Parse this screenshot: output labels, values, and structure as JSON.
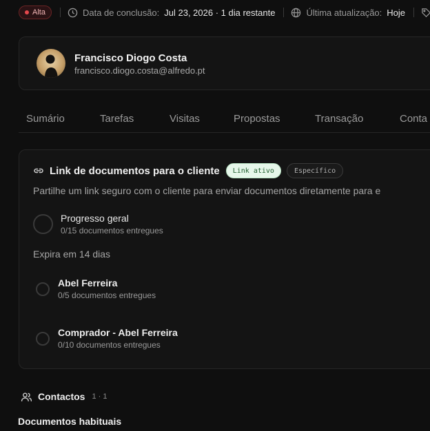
{
  "meta": {
    "priority": "Alta",
    "due_label": "Data de conclusão:",
    "due_value": "Jul 23, 2026 · 1 dia restante",
    "updated_label": "Última atualização:",
    "updated_value": "Hoje",
    "colors": {
      "priority_dot": "#e5484d"
    }
  },
  "profile": {
    "name": "Francisco Diogo Costa",
    "email": "francisco.diogo.costa@alfredo.pt"
  },
  "tabs": [
    {
      "label": "Sumário"
    },
    {
      "label": "Tarefas"
    },
    {
      "label": "Visitas"
    },
    {
      "label": "Propostas"
    },
    {
      "label": "Transação"
    },
    {
      "label": "Conta"
    }
  ],
  "doc_link": {
    "title": "Link de documentos para o cliente",
    "badge_active": "Link ativo",
    "badge_specific": "Específico",
    "description": "Partilhe um link seguro com o cliente para enviar documentos diretamente para e",
    "progress_title": "Progresso geral",
    "progress_sub": "0/15 documentos entregues",
    "progress_fraction": 0,
    "expires": "Expira em 14 dias",
    "people": [
      {
        "name": "Abel Ferreira",
        "sub": "0/5 documentos entregues"
      },
      {
        "name": "Comprador - Abel Ferreira",
        "sub": "0/10 documentos entregues"
      }
    ],
    "colors": {
      "badge_active_bg": "#e6f7ea",
      "badge_active_fg": "#1f5d2e"
    }
  },
  "contacts": {
    "label": "Contactos",
    "count": "1 · 1"
  },
  "docs_heading": "Documentos habituais"
}
